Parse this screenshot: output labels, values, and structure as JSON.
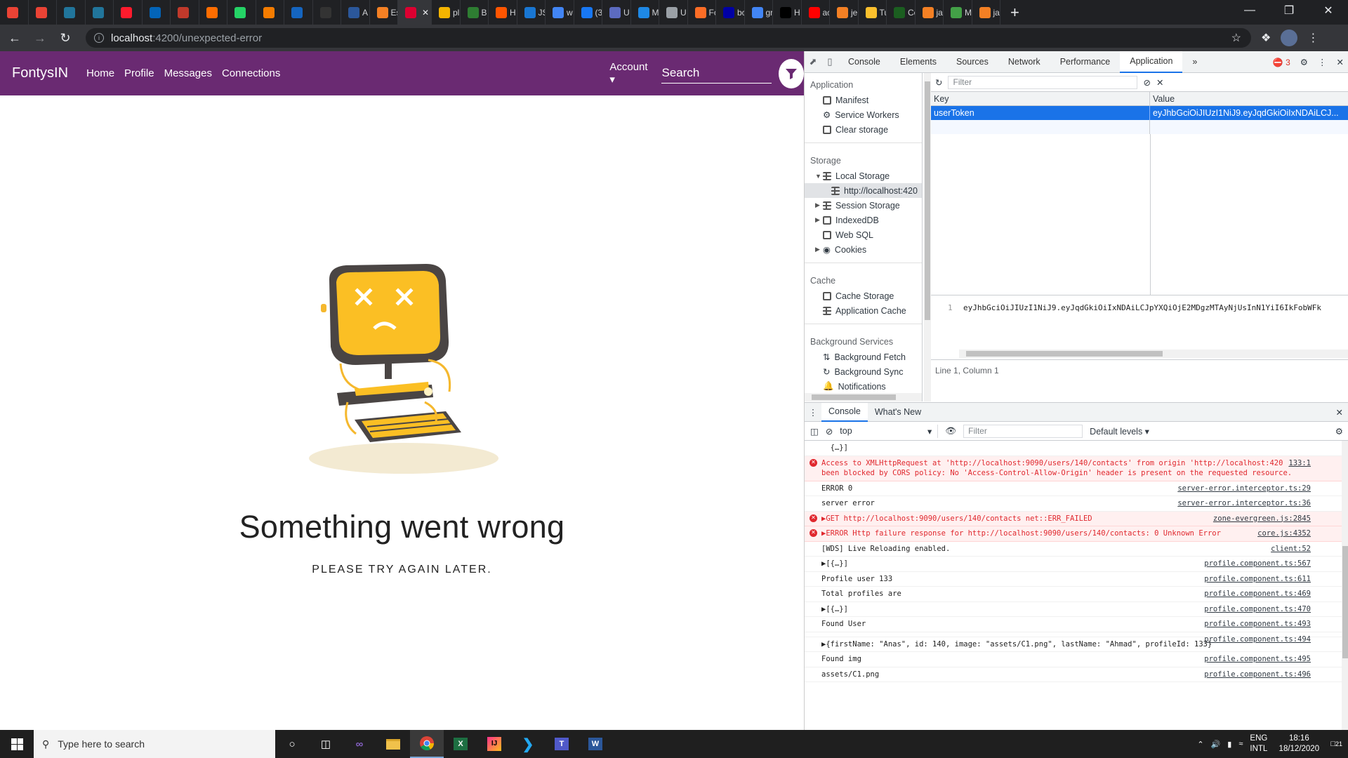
{
  "browser": {
    "tabs": [
      {
        "label": "",
        "icon": "gmail-icon",
        "color": "#ea4335"
      },
      {
        "label": "",
        "icon": "gmail-icon",
        "color": "#ea4335"
      },
      {
        "label": "",
        "icon": "wordpress-icon",
        "color": "#21759b"
      },
      {
        "label": "",
        "icon": "wordpress-icon",
        "color": "#21759b"
      },
      {
        "label": "",
        "icon": "opera-icon",
        "color": "#ff1b2d"
      },
      {
        "label": "",
        "icon": "onedrive-icon",
        "color": "#0364b8"
      },
      {
        "label": "",
        "icon": "redline-icon",
        "color": "#c0392b"
      },
      {
        "label": "",
        "icon": "bookmark-icon",
        "color": "#ff6d00"
      },
      {
        "label": "",
        "icon": "whatsapp-icon",
        "color": "#25d366"
      },
      {
        "label": "",
        "icon": "orange-square-icon",
        "color": "#f57c00"
      },
      {
        "label": "",
        "icon": "tr-icon",
        "color": "#1565c0"
      },
      {
        "label": "",
        "icon": "github-icon",
        "color": "#333333"
      },
      {
        "label": "A",
        "icon": "word-icon",
        "color": "#2b579a"
      },
      {
        "label": "Es",
        "icon": "stackoverflow-icon",
        "color": "#f48024"
      },
      {
        "label": "",
        "icon": "angular-icon",
        "color": "#dd0031",
        "active": true
      },
      {
        "label": "pl",
        "icon": "stripes-icon",
        "color": "#f4b400"
      },
      {
        "label": "B",
        "icon": "b64-icon",
        "color": "#2e7d32"
      },
      {
        "label": "H",
        "icon": "soundcloud-icon",
        "color": "#ff5500"
      },
      {
        "label": "JS",
        "icon": "json-icon",
        "color": "#1976d2"
      },
      {
        "label": "w",
        "icon": "google-icon",
        "color": "#4285f4"
      },
      {
        "label": "(3",
        "icon": "facebook-icon",
        "color": "#1877f2"
      },
      {
        "label": "U",
        "icon": "uml-icon",
        "color": "#5c6bc0"
      },
      {
        "label": "M",
        "icon": "monitor-icon",
        "color": "#1e88e5"
      },
      {
        "label": "U",
        "icon": "udemy-icon",
        "color": "#9aa0a6"
      },
      {
        "label": "Fc",
        "icon": "gitlab-icon",
        "color": "#fc6d26"
      },
      {
        "label": "bc",
        "icon": "bol-icon",
        "color": "#0000a4"
      },
      {
        "label": "gr",
        "icon": "google-icon",
        "color": "#4285f4"
      },
      {
        "label": "H",
        "icon": "p-icon",
        "color": "#000000"
      },
      {
        "label": "ac",
        "icon": "youtube-icon",
        "color": "#ff0000"
      },
      {
        "label": "je",
        "icon": "stackoverflow-icon",
        "color": "#f48024"
      },
      {
        "label": "Tu",
        "icon": "yellow-square-icon",
        "color": "#fbc02d"
      },
      {
        "label": "Cc",
        "icon": "dark-icon",
        "color": "#1b5e20"
      },
      {
        "label": "ja",
        "icon": "stackoverflow-icon",
        "color": "#f48024"
      },
      {
        "label": "M",
        "icon": "green-square-icon",
        "color": "#43a047"
      },
      {
        "label": "ja",
        "icon": "stackoverflow-icon",
        "color": "#f48024"
      }
    ],
    "url_host": "localhost",
    "url_path": ":4200/unexpected-error"
  },
  "app": {
    "brand": "FontysIN",
    "nav": [
      "Home",
      "Profile",
      "Messages",
      "Connections"
    ],
    "account": "Account ▾",
    "search_label": "Search",
    "nav_bg": "#6a2a72"
  },
  "error_page": {
    "title": "Something went wrong",
    "subtitle": "PLEASE TRY AGAIN LATER."
  },
  "devtools": {
    "tabs": [
      "Console",
      "Elements",
      "Sources",
      "Network",
      "Performance",
      "Application"
    ],
    "active_tab": "Application",
    "more": "»",
    "error_count": "3",
    "sidebar": {
      "application_head": "Application",
      "application_items": [
        "Manifest",
        "Service Workers",
        "Clear storage"
      ],
      "storage_head": "Storage",
      "local_storage": "Local Storage",
      "local_storage_child": "http://localhost:420",
      "storage_items": [
        "Session Storage",
        "IndexedDB",
        "Web SQL",
        "Cookies"
      ],
      "cache_head": "Cache",
      "cache_items": [
        "Cache Storage",
        "Application Cache"
      ],
      "bg_head": "Background Services",
      "bg_items": [
        "Background Fetch",
        "Background Sync",
        "Notifications"
      ]
    },
    "storage": {
      "filter_placeholder": "Filter",
      "col_key": "Key",
      "col_value": "Value",
      "row_key": "userToken",
      "row_value": "eyJhbGciOiJIUzI1NiJ9.eyJqdGkiOiIxNDAiLCJ...",
      "line_no": "1",
      "value_code": "eyJhbGciOiJIUzI1NiJ9.eyJqdGkiOiIxNDAiLCJpYXQiOjE2MDgzMTAyNjUsInN1YiI6IkFobWFk",
      "status": "Line 1, Column 1"
    },
    "drawer": {
      "tabs": [
        "Console",
        "What's New"
      ],
      "context": "top",
      "filter_placeholder": "Filter",
      "levels": "Default levels ▾",
      "messages": [
        {
          "type": "log",
          "text": "  {…}]",
          "src": ""
        },
        {
          "type": "error",
          "text": "Access to XMLHttpRequest at 'http://localhost:9090/users/140/contacts' from origin 'http://localhost:4200' has been blocked by CORS policy: No 'Access-Control-Allow-Origin' header is present on the requested resource.",
          "src": "133:1"
        },
        {
          "type": "log",
          "text": "ERROR 0",
          "src": "server-error.interceptor.ts:29"
        },
        {
          "type": "log",
          "text": "server error",
          "src": "server-error.interceptor.ts:36"
        },
        {
          "type": "error",
          "text": "▶GET http://localhost:9090/users/140/contacts net::ERR_FAILED",
          "src": "zone-evergreen.js:2845"
        },
        {
          "type": "error",
          "text": "▶ERROR Http failure response for http://localhost:9090/users/140/contacts: 0 Unknown Error",
          "src": "core.js:4352"
        },
        {
          "type": "log",
          "text": "[WDS] Live Reloading enabled.",
          "src": "client:52"
        },
        {
          "type": "log",
          "text": "▶[{…}]",
          "src": "profile.component.ts:567"
        },
        {
          "type": "log",
          "text": "Profile user 133",
          "src": "profile.component.ts:611"
        },
        {
          "type": "log",
          "text": "Total profiles are",
          "src": "profile.component.ts:469"
        },
        {
          "type": "log",
          "text": "▶[{…}]",
          "src": "profile.component.ts:470"
        },
        {
          "type": "log",
          "text": "Found User",
          "src": "profile.component.ts:493"
        },
        {
          "type": "log",
          "text": "",
          "src": "profile.component.ts:494"
        },
        {
          "type": "log",
          "text": "▶{firstName: \"Anas\", id: 140, image: \"assets/C1.png\", lastName: \"Ahmad\", profileId: 133}",
          "src": ""
        },
        {
          "type": "log",
          "text": "Found img",
          "src": "profile.component.ts:495"
        },
        {
          "type": "log",
          "text": "assets/C1.png",
          "src": "profile.component.ts:496"
        }
      ]
    }
  },
  "taskbar": {
    "search_placeholder": "Type here to search",
    "lang": "ENG",
    "lang2": "INTL",
    "time": "18:16",
    "date": "18/12/2020",
    "notif": "21"
  }
}
